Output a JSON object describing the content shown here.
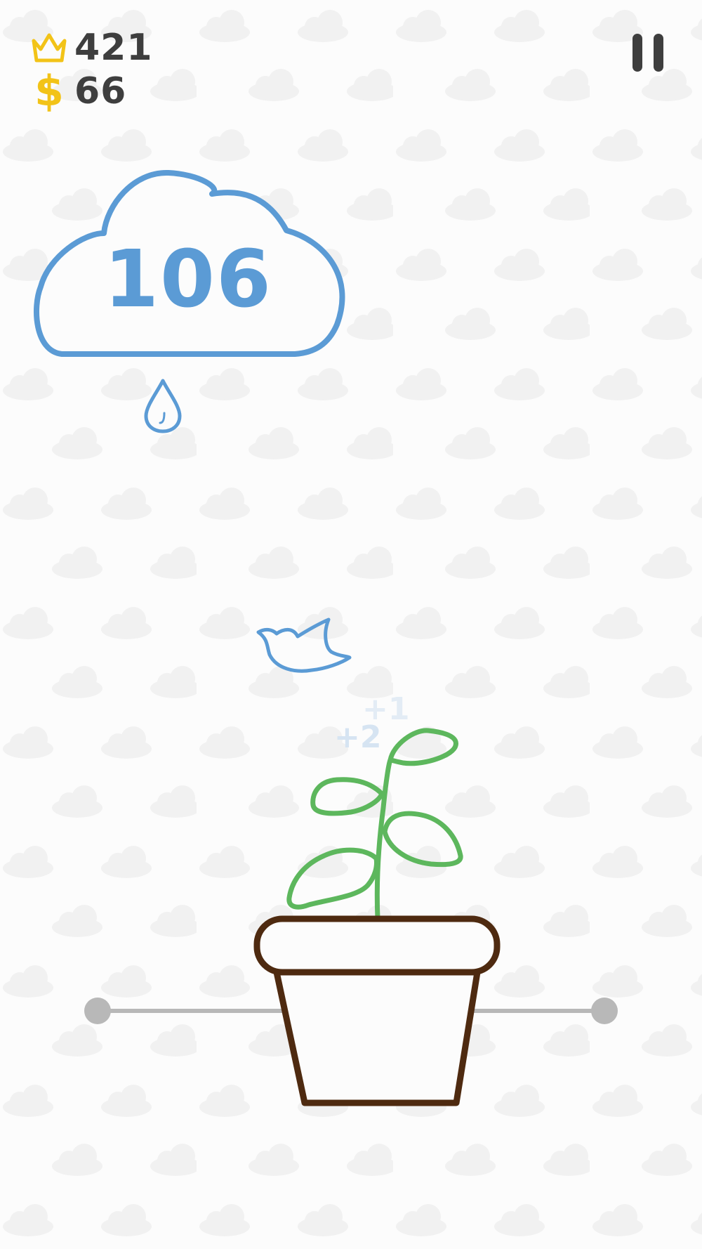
{
  "hud": {
    "best_score": "421",
    "coins": "66",
    "coin_symbol": "$",
    "best_icon": "crown-icon",
    "pause_icon": "pause-icon"
  },
  "cloud": {
    "count": "106",
    "drop_icon": "water-drop-icon"
  },
  "floating_points": [
    "+1",
    "+2"
  ],
  "sprites": {
    "bird": "bird-icon",
    "plant": "sprout-icon",
    "pot": "flower-pot-icon"
  },
  "colors": {
    "background": "#fcfcfc",
    "pattern_cloud": "#f1f1f1",
    "accent_blue": "#5b9bd5",
    "crown_gold": "#f2c318",
    "text_dark": "#3e3e3e",
    "plant_green": "#5db75d",
    "pot_brown": "#4e2a10",
    "rail_gray": "#b8b8b8"
  }
}
